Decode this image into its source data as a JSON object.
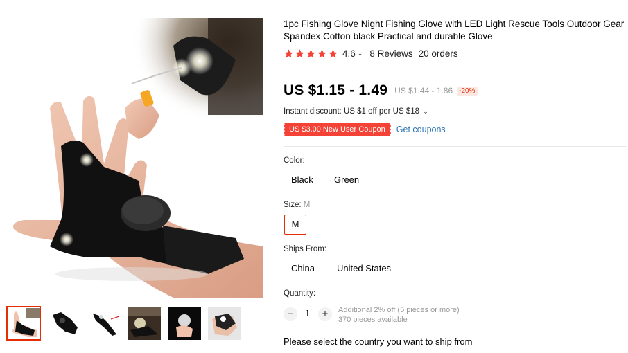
{
  "product": {
    "title": "1pc Fishing Glove Night Fishing Glove with LED Light Rescue Tools Outdoor Gear Spandex Cotton black Practical and durable Glove",
    "rating": "4.6",
    "reviews": "8 Reviews",
    "orders": "20 orders",
    "stars": 5,
    "star_color": "#f44336"
  },
  "price": {
    "current": "US $1.15 - 1.49",
    "original": "US $1.44 - 1.86",
    "discount": "-20%",
    "instant_discount": "Instant discount: US $1 off per US $18",
    "coupon": "US $3.00 New User Coupon",
    "get_coupons": "Get coupons"
  },
  "color": {
    "label": "Color:",
    "options": [
      "Black",
      "Green"
    ]
  },
  "size": {
    "label": "Size:",
    "selected": "M",
    "options": [
      "M"
    ]
  },
  "ships_from": {
    "label": "Ships From:",
    "options": [
      "China",
      "United States"
    ]
  },
  "quantity": {
    "label": "Quantity:",
    "value": "1",
    "minus": "−",
    "plus": "+",
    "note_discount": "Additional 2% off (5 pieces or more)",
    "note_available": "370 pieces available"
  },
  "shipping_prompt": "Please select the country you want to ship from",
  "accent_color": "#e62e04",
  "link_color": "#2e75b6"
}
